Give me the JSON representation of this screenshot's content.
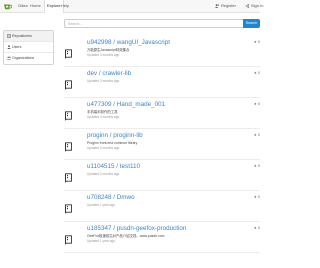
{
  "nav": {
    "items": [
      {
        "label": "Gitea"
      },
      {
        "label": "Home"
      },
      {
        "label": "Explore"
      },
      {
        "label": "Help"
      }
    ],
    "register_label": "Register",
    "signin_label": "Sign In"
  },
  "sidebar": {
    "items": [
      {
        "label": "Repositories"
      },
      {
        "label": "Users"
      },
      {
        "label": "Organizations"
      }
    ]
  },
  "search": {
    "placeholder": "Search...",
    "button_label": "Search"
  },
  "repos": [
    {
      "name": "u942998 / wangUI_Javascript",
      "description": "万能原生Javascript特效集合",
      "updated": "Updated 3 months ago",
      "stars": "0"
    },
    {
      "name": "dev / crawler-lib",
      "description": "",
      "updated": "Updated 3 months ago",
      "stars": "0"
    },
    {
      "name": "u477309 / Hand_made_001",
      "description": "手机端手制作的工具",
      "updated": "Updated 3 months ago",
      "stars": "0"
    },
    {
      "name": "proginn / proginn-lib",
      "description": "Proginn front-end common library",
      "updated": "Updated 3 months ago",
      "stars": "0"
    },
    {
      "name": "u1104515 / test110",
      "description": "",
      "updated": "Updated 3 months ago",
      "stars": "0"
    },
    {
      "name": "u708248 / Dmwo",
      "description": "",
      "updated": "Updated 1 year ago",
      "stars": "0"
    },
    {
      "name": "u185347 / pusdn-geefox-production",
      "description": "GeeFox极速前沿对产品介绍文档，www.pusdn.com",
      "updated": "Updated 1 year ago",
      "stars": "0"
    }
  ],
  "colors": {
    "accent": "#2185d0",
    "link": "#4183c4",
    "logo": "#609926"
  },
  "icons": {
    "logo": "gitea-logo-icon",
    "register": "register-user-icon",
    "signin": "sign-in-icon",
    "repositories": "book-icon",
    "users": "user-icon",
    "organizations": "organization-icon",
    "repo": "repo-icon",
    "star": "star-icon"
  }
}
